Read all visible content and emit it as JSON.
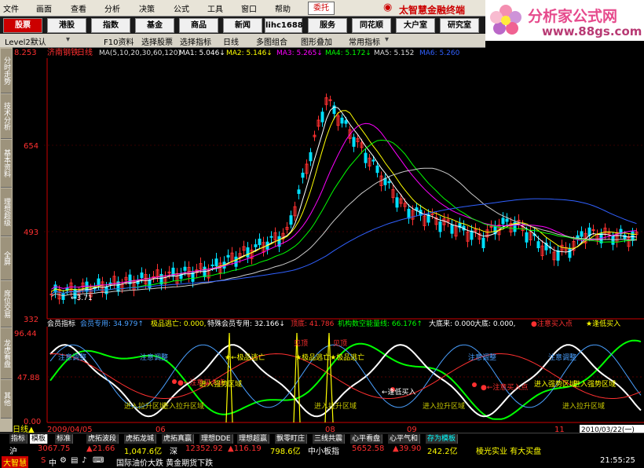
{
  "menu": [
    "文件",
    "画面",
    "查看",
    "分析",
    "决策",
    "公式",
    "工具",
    "窗口",
    "帮助"
  ],
  "trust_label": "委托",
  "brand": "太智慧金融终端",
  "logo": {
    "title": "分析家公式网",
    "url": "www.88gs.com"
  },
  "nav": [
    "股票",
    "港股",
    "指数",
    "基金",
    "商品",
    "新闻",
    "lihc1688",
    "服务",
    "同花顺",
    "大户室",
    "研究室"
  ],
  "toolbar": [
    "Level2默认",
    "F10资料",
    "选择股票",
    "选择指标",
    "日线",
    "多图组合",
    "图形叠加",
    "常用指标"
  ],
  "side_tabs": [
    "分时走势",
    "技术分析",
    "基本资料",
    "理想超级",
    "全屏",
    "席位交易",
    "龙虎看盘",
    "其他"
  ],
  "stock_name": "济南钢铁",
  "period": "日线",
  "ma_params": "MA(5,10,20,30,60,120)",
  "ma_labels": [
    {
      "text": "MA1: 5.046↓",
      "color": "#ffffff"
    },
    {
      "text": "MA2: 5.146↓",
      "color": "#ffff00"
    },
    {
      "text": "MA3: 5.265↓",
      "color": "#ff00ff"
    },
    {
      "text": "MA4: 5.172↓",
      "color": "#00ff00"
    },
    {
      "text": "MA5: 5.152",
      "color": "#dddddd"
    },
    {
      "text": "MA6: 5.260",
      "color": "#3060ff"
    }
  ],
  "price_axis": {
    "top": "8.253",
    "mid1": "654",
    "mid2": "493",
    "bottom": "332"
  },
  "low_label": "←3.71",
  "indicator": {
    "labels": [
      {
        "text": "会员指标",
        "color": "#ffffff"
      },
      {
        "text": "会员专用: 34.979↑",
        "color": "#4aa0ff"
      },
      {
        "text": "极品逃亡: 0.000,",
        "color": "#ffff00"
      },
      {
        "text": "特殊会员专用: 32.166↓",
        "color": "#ffffff"
      },
      {
        "text": "顶底: 41.786",
        "color": "#ff3030"
      },
      {
        "text": "机构数空能量线: 66.176↑",
        "color": "#00ff00"
      },
      {
        "text": "大底来: 0.000,",
        "color": "#ffffff"
      },
      {
        "text": "大底: 0.000,",
        "color": "#ffffff"
      },
      {
        "text": "●注意买入点",
        "color": "#ff3030"
      },
      {
        "text": "★逢低买入",
        "color": "#ffff00"
      }
    ],
    "axis": {
      "top": "96.44",
      "mid": "47.88",
      "bottom": "0.00"
    },
    "annotations": [
      {
        "text": "注意调整",
        "color": "#4aa0ff"
      },
      {
        "text": "注意调整",
        "color": "#4aa0ff"
      },
      {
        "text": "★←极品逃亡",
        "color": "#ffff00"
      },
      {
        "text": "★极品逃亡★极品逃亡",
        "color": "#ffff00"
      },
      {
        "text": "注意调整",
        "color": "#4aa0ff"
      },
      {
        "text": "注意调整",
        "color": "#4aa0ff"
      },
      {
        "text": "●←注意买入点",
        "color": "#ff3030"
      },
      {
        "text": "进入强势区域",
        "color": "#ffff00"
      },
      {
        "text": "←逢低买入",
        "color": "#ffffff"
      },
      {
        "text": "●←注意买入点",
        "color": "#ff3030"
      },
      {
        "text": "进入强势区域",
        "color": "#ffff00"
      },
      {
        "text": "进入强势区域",
        "color": "#ffff00"
      },
      {
        "text": "进入拉升区域",
        "color": "#c8c800"
      },
      {
        "text": "进入拉升区域",
        "color": "#c8c800"
      },
      {
        "text": "进入拉升区域",
        "color": "#c8c800"
      },
      {
        "text": "进入拉升区域",
        "color": "#c8c800"
      },
      {
        "text": "进入拉升区域",
        "color": "#c8c800"
      },
      {
        "text": "见顶",
        "color": "#ff3030"
      },
      {
        "text": "见顶",
        "color": "#ff3030"
      }
    ]
  },
  "date_axis": {
    "period": "日线▲",
    "start": "2009/04/05",
    "m06": "06",
    "m08": "08",
    "m09": "09",
    "m11": "11",
    "current": "2010/03/22(一)"
  },
  "tabs": [
    "指标",
    "模板",
    "标准",
    "虎拓波段",
    "虎拓龙城",
    "虎拓真赢",
    "理想DDE",
    "理想超赢",
    "飘零盯庄",
    "三线共震",
    "心平看盘",
    "心平气和",
    "存为模板"
  ],
  "ticker": [
    {
      "text": "沪",
      "color": "#ffffff"
    },
    {
      "text": "3067.75",
      "color": "#ff3030"
    },
    {
      "text": "▲21.66",
      "color": "#ff3030"
    },
    {
      "text": "1,047.6亿",
      "color": "#ffff00"
    },
    {
      "text": "深",
      "color": "#ffffff"
    },
    {
      "text": "12352.92",
      "color": "#ff3030"
    },
    {
      "text": "▲116.19",
      "color": "#ff3030"
    },
    {
      "text": "798.6亿",
      "color": "#ffff00"
    },
    {
      "text": "中小板指",
      "color": "#ffffff"
    },
    {
      "text": "5652.58",
      "color": "#ff3030"
    },
    {
      "text": "▲39.90",
      "color": "#ff3030"
    },
    {
      "text": "242.2亿",
      "color": "#ffff00"
    },
    {
      "text": "棱光实业 有大买盘",
      "color": "#ffff00"
    }
  ],
  "news": "国际油价大跌 黄金期货下跌",
  "status_left": "大智慧",
  "clock": "21:55:25"
}
